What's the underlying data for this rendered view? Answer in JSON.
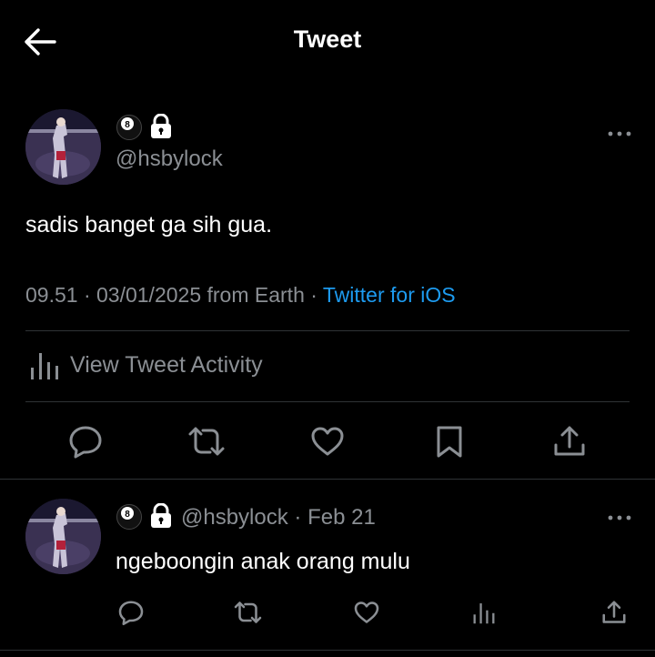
{
  "header": {
    "title": "Tweet"
  },
  "tweet": {
    "handle": "@hsbylock",
    "text": "sadis banget ga sih gua.",
    "timestamp": "09.51 · 03/01/2025 from Earth · ",
    "source": "Twitter for iOS",
    "activity_label": "View Tweet Activity"
  },
  "reply": {
    "handle": "@hsbylock",
    "date_separator": " · ",
    "date": "Feb 21",
    "text": "ngeboongin anak orang mulu"
  },
  "colors": {
    "background": "#000000",
    "accent": "#1d9bf0",
    "muted": "#8b8f94",
    "divider": "#2f3336"
  }
}
